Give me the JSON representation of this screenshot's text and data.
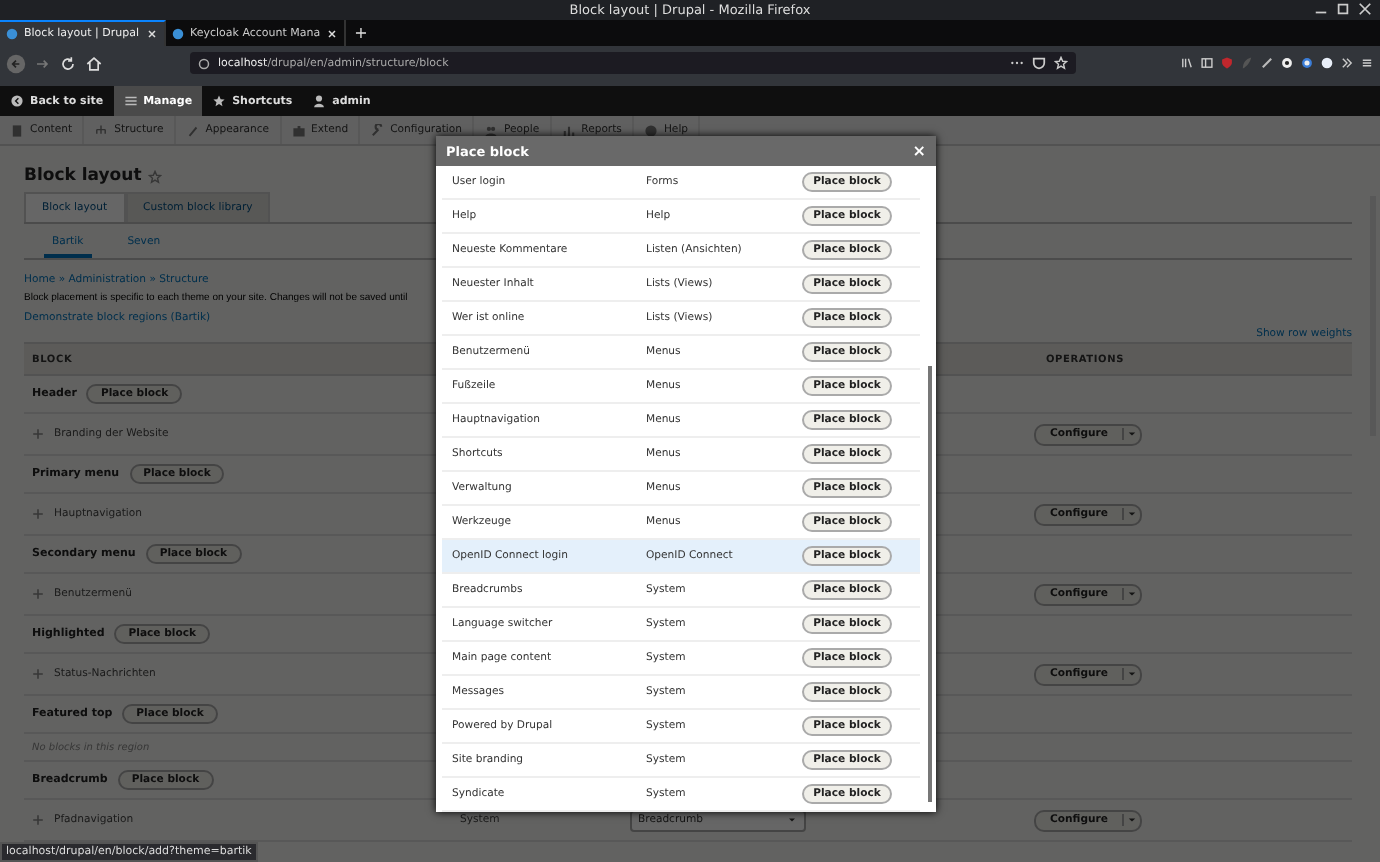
{
  "os_window": {
    "title": "Block layout | Drupal - Mozilla Firefox"
  },
  "browser": {
    "tabs": [
      {
        "label": "Block layout | Drupal",
        "selected": true
      },
      {
        "label": "Keycloak Account Mana",
        "selected": false
      }
    ],
    "new_tab": "+",
    "url": {
      "host": "localhost",
      "path": "/drupal/en/admin/structure/block"
    }
  },
  "toolbar": {
    "items": [
      {
        "label": "Back to site",
        "selected": false
      },
      {
        "label": "Manage",
        "selected": true
      },
      {
        "label": "Shortcuts",
        "selected": false
      },
      {
        "label": "admin",
        "selected": false
      }
    ]
  },
  "tray": {
    "items": [
      "Content",
      "Structure",
      "Appearance",
      "Extend",
      "Configuration",
      "People",
      "Reports",
      "Help"
    ]
  },
  "page": {
    "title": "Block layout",
    "tabs": [
      {
        "label": "Block layout",
        "selected": true
      },
      {
        "label": "Custom block library",
        "selected": false
      }
    ],
    "subtabs": [
      {
        "label": "Bartik",
        "selected": true
      },
      {
        "label": "Seven",
        "selected": false
      }
    ],
    "breadcrumb": "Home » Administration » Structure",
    "description": "Block placement is specific to each theme on your site. Changes will not be saved until",
    "demo_link": "Demonstrate block regions (Bartik)",
    "row_weights_link": "Show row weights",
    "table": {
      "columns": [
        "BLOCK",
        "OPERATIONS"
      ],
      "rows": [
        {
          "kind": "region",
          "label": "Header",
          "button": "Place block"
        },
        {
          "kind": "block",
          "label": "Branding der Website",
          "operation": "Configure"
        },
        {
          "kind": "region",
          "label": "Primary menu",
          "button": "Place block"
        },
        {
          "kind": "block",
          "label": "Hauptnavigation",
          "operation": "Configure"
        },
        {
          "kind": "region",
          "label": "Secondary menu",
          "button": "Place block"
        },
        {
          "kind": "block",
          "label": "Benutzermenü",
          "operation": "Configure"
        },
        {
          "kind": "region",
          "label": "Highlighted",
          "button": "Place block"
        },
        {
          "kind": "block",
          "label": "Status-Nachrichten",
          "operation": "Configure"
        },
        {
          "kind": "region",
          "label": "Featured top",
          "button": "Place block"
        },
        {
          "kind": "empty",
          "label": "No blocks in this region"
        },
        {
          "kind": "region",
          "label": "Breadcrumb",
          "button": "Place block"
        },
        {
          "kind": "block",
          "label": "Pfadnavigation",
          "category": "System",
          "region": "Breadcrumb",
          "operation": "Configure"
        }
      ]
    }
  },
  "modal": {
    "title": "Place block",
    "close": "×",
    "rows": [
      {
        "name": "User login",
        "category": "Forms",
        "button": "Place block",
        "hovered": false
      },
      {
        "name": "Help",
        "category": "Help",
        "button": "Place block",
        "hovered": false
      },
      {
        "name": "Neueste Kommentare",
        "category": "Listen (Ansichten)",
        "button": "Place block",
        "hovered": false
      },
      {
        "name": "Neuester Inhalt",
        "category": "Lists (Views)",
        "button": "Place block",
        "hovered": false
      },
      {
        "name": "Wer ist online",
        "category": "Lists (Views)",
        "button": "Place block",
        "hovered": false
      },
      {
        "name": "Benutzermenü",
        "category": "Menus",
        "button": "Place block",
        "hovered": false
      },
      {
        "name": "Fußzeile",
        "category": "Menus",
        "button": "Place block",
        "hovered": false
      },
      {
        "name": "Hauptnavigation",
        "category": "Menus",
        "button": "Place block",
        "hovered": false
      },
      {
        "name": "Shortcuts",
        "category": "Menus",
        "button": "Place block",
        "hovered": false
      },
      {
        "name": "Verwaltung",
        "category": "Menus",
        "button": "Place block",
        "hovered": false
      },
      {
        "name": "Werkzeuge",
        "category": "Menus",
        "button": "Place block",
        "hovered": false
      },
      {
        "name": "OpenID Connect login",
        "category": "OpenID Connect",
        "button": "Place block",
        "hovered": true
      },
      {
        "name": "Breadcrumbs",
        "category": "System",
        "button": "Place block",
        "hovered": false
      },
      {
        "name": "Language switcher",
        "category": "System",
        "button": "Place block",
        "hovered": false
      },
      {
        "name": "Main page content",
        "category": "System",
        "button": "Place block",
        "hovered": false
      },
      {
        "name": "Messages",
        "category": "System",
        "button": "Place block",
        "hovered": false
      },
      {
        "name": "Powered by Drupal",
        "category": "System",
        "button": "Place block",
        "hovered": false
      },
      {
        "name": "Site branding",
        "category": "System",
        "button": "Place block",
        "hovered": false
      },
      {
        "name": "Syndicate",
        "category": "System",
        "button": "Place block",
        "hovered": false
      }
    ]
  },
  "status_url": "localhost/drupal/en/block/add?theme=bartik"
}
